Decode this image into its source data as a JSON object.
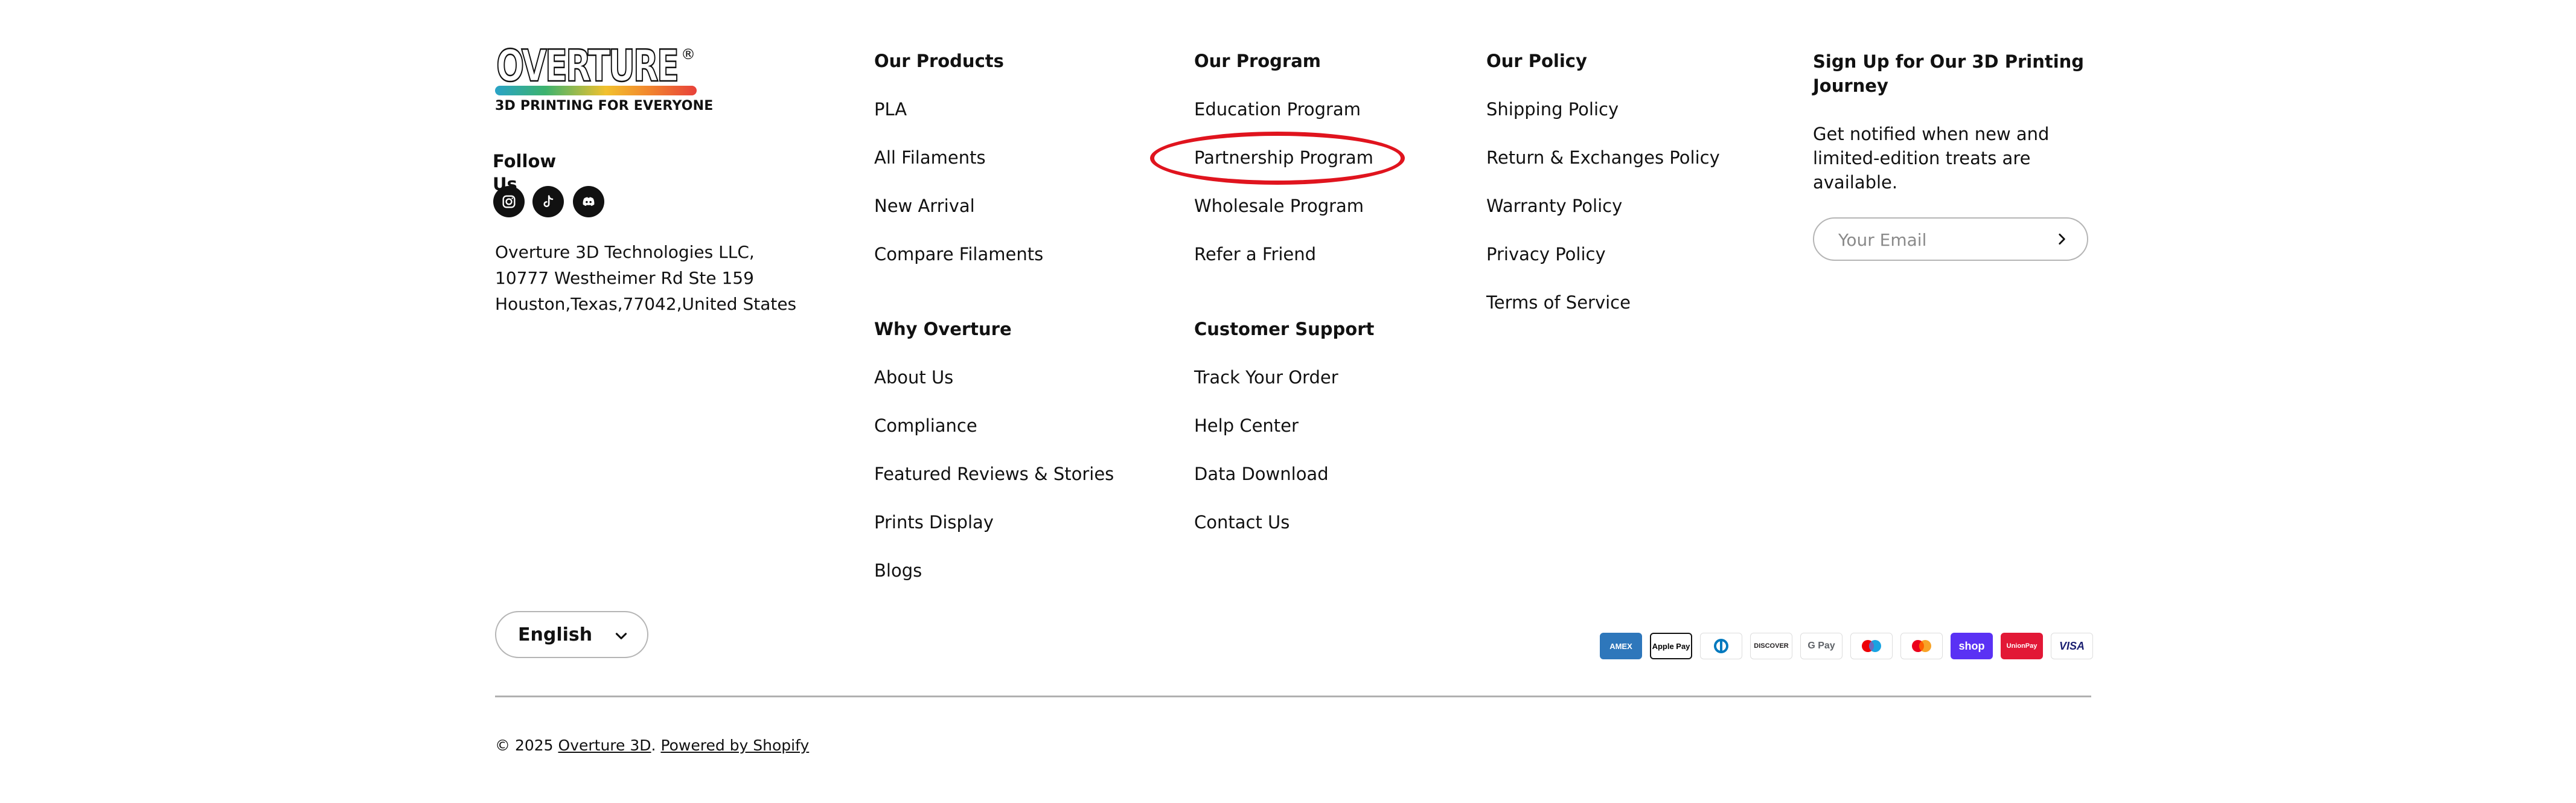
{
  "brand": {
    "wordmark": "OVERTURE",
    "registered": "®",
    "tagline": "3D PRINTING FOR EVERYONE"
  },
  "follow": {
    "label": "Follow Us",
    "social": [
      {
        "icon": "instagram-icon"
      },
      {
        "icon": "tiktok-icon"
      },
      {
        "icon": "discord-icon"
      }
    ]
  },
  "address": {
    "line1": "Overture 3D Technologies LLC,",
    "line2": "10777 Westheimer Rd Ste 159",
    "line3": "Houston,Texas,77042,United States"
  },
  "columns": {
    "products": {
      "title": "Our Products",
      "links": [
        "PLA",
        "All Filaments",
        "New Arrival",
        "Compare Filaments"
      ]
    },
    "why": {
      "title": "Why Overture",
      "links": [
        "About Us",
        "Compliance",
        "Featured Reviews & Stories",
        "Prints Display",
        "Blogs"
      ]
    },
    "program": {
      "title": "Our Program",
      "links": [
        "Education Program",
        "Partnership Program",
        "Wholesale Program",
        "Refer a Friend"
      ]
    },
    "support": {
      "title": "Customer Support",
      "links": [
        "Track Your Order",
        "Help Center",
        "Data Download",
        "Contact Us"
      ]
    },
    "policy": {
      "title": "Our Policy",
      "links": [
        "Shipping Policy",
        "Return & Exchanges Policy",
        "Warranty Policy",
        "Privacy Policy",
        "Terms of Service"
      ]
    }
  },
  "signup": {
    "title": "Sign Up for Our 3D Printing Journey",
    "text": "Get notified when new and limited-edition treats are available.",
    "placeholder": "Your Email"
  },
  "language": {
    "selected": "English"
  },
  "payments": [
    {
      "label": "AMEX",
      "icon": "amex-icon",
      "bg": "#2e77bb",
      "fg": "#ffffff"
    },
    {
      "label": "Apple Pay",
      "icon": "apple-pay-icon",
      "bg": "#ffffff",
      "fg": "#000000"
    },
    {
      "label": "D",
      "icon": "diners-club-icon",
      "bg": "#ffffff",
      "fg": "#0079be"
    },
    {
      "label": "DISCOVER",
      "icon": "discover-icon",
      "bg": "#ffffff",
      "fg": "#231f20"
    },
    {
      "label": "G Pay",
      "icon": "google-pay-icon",
      "bg": "#ffffff",
      "fg": "#5f6368"
    },
    {
      "label": "",
      "icon": "maestro-icon",
      "bg": "#ffffff",
      "fg": "#000000"
    },
    {
      "label": "",
      "icon": "mastercard-icon",
      "bg": "#ffffff",
      "fg": "#000000"
    },
    {
      "label": "shop",
      "icon": "shop-pay-icon",
      "bg": "#5a31f4",
      "fg": "#ffffff"
    },
    {
      "label": "UnionPay",
      "icon": "unionpay-icon",
      "bg": "#e21836",
      "fg": "#ffffff"
    },
    {
      "label": "VISA",
      "icon": "visa-icon",
      "bg": "#ffffff",
      "fg": "#1a1f71"
    }
  ],
  "copyright": {
    "prefix": "© 2025",
    "company": "Overture 3D",
    "powered": "Powered by Shopify"
  },
  "colors": {
    "highlight": "#e0141e",
    "text": "#111111",
    "border": "#b5b5b5"
  }
}
